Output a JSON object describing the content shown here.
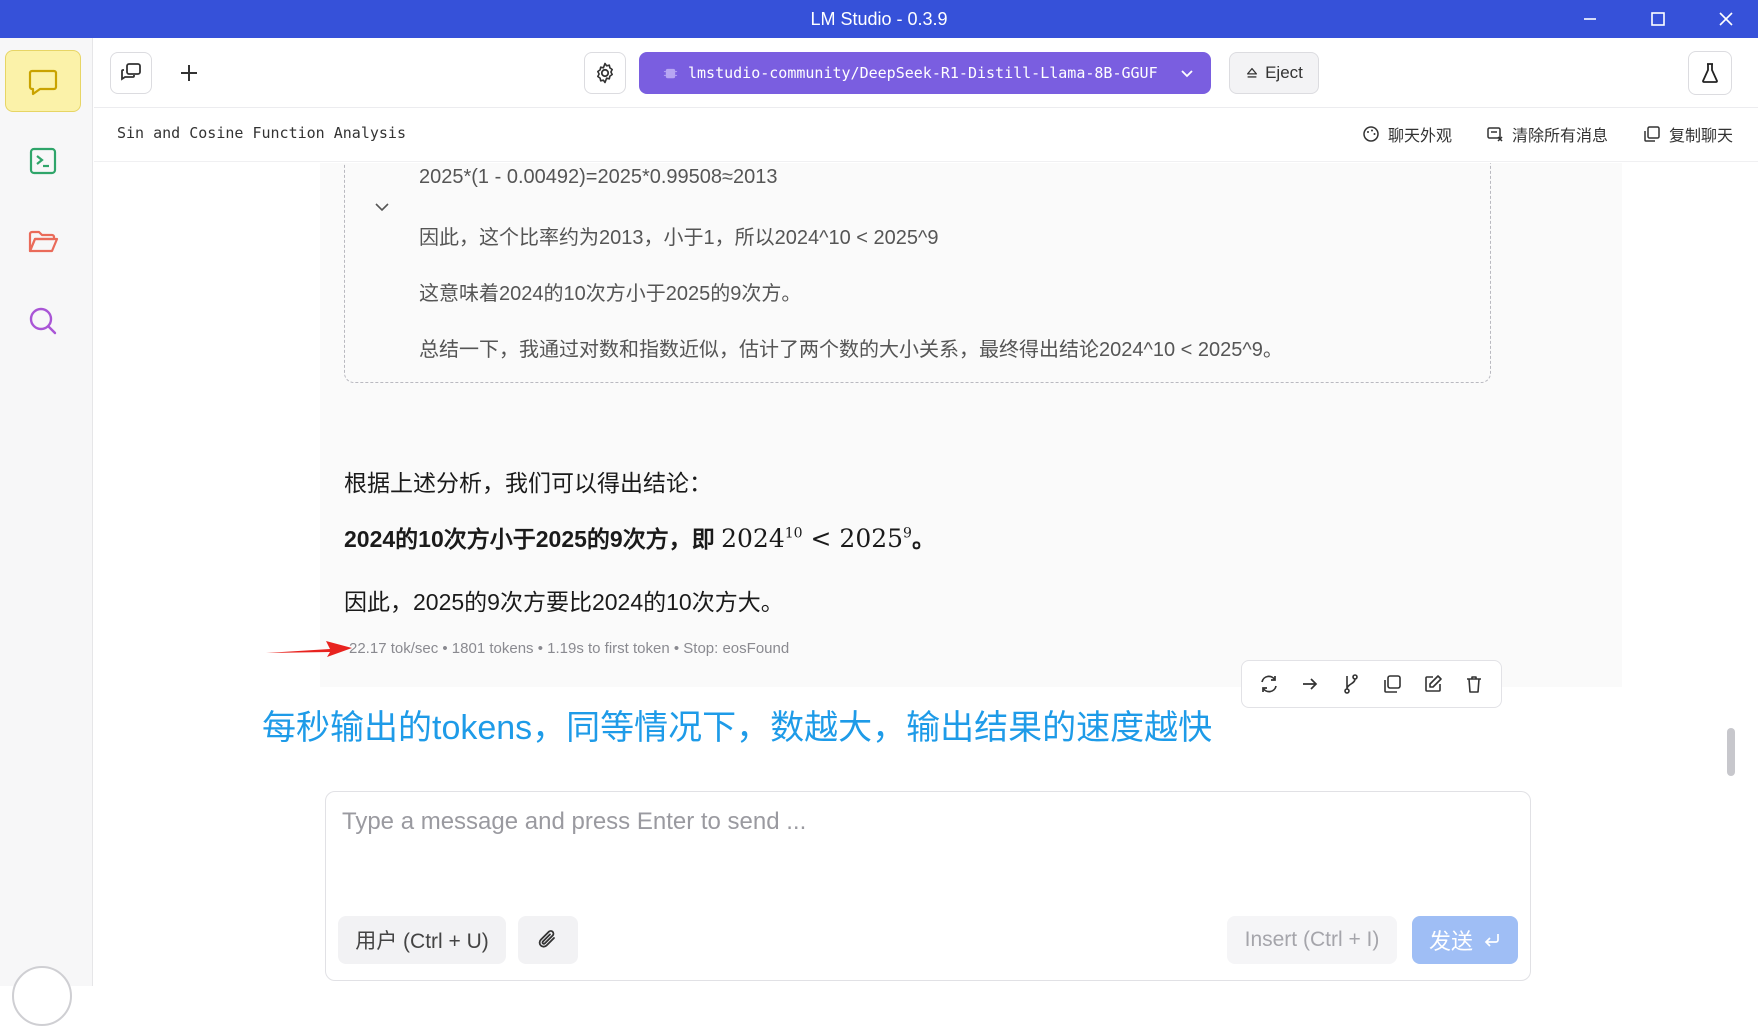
{
  "window": {
    "title": "LM Studio - 0.3.9"
  },
  "sidebar": {
    "items": [
      {
        "icon": "chat-icon",
        "active": true
      },
      {
        "icon": "terminal-icon",
        "active": false
      },
      {
        "icon": "folder-icon",
        "active": false
      },
      {
        "icon": "search-icon",
        "active": false
      }
    ]
  },
  "toolbar": {
    "model_name": "lmstudio-community/DeepSeek-R1-Distill-Llama-8B-GGUF",
    "eject_label": "Eject"
  },
  "chat_header": {
    "title": "Sin and Cosine Function Analysis",
    "actions": [
      "聊天外观",
      "清除所有消息",
      "复制聊天"
    ]
  },
  "thought": {
    "lines": [
      "2025*(1 - 0.00492)=2025*0.99508≈2013",
      "因此，这个比率约为2013，小于1，所以2024^10 < 2025^9",
      "这意味着2024的10次方小于2025的9次方。",
      "总结一下，我通过对数和指数近似，估计了两个数的大小关系，最终得出结论2024^10 < 2025^9。"
    ]
  },
  "answer": {
    "intro": "根据上述分析，我们可以得出结论：",
    "conclusion_bold": "2024的10次方小于2025的9次方，即",
    "math": {
      "base1": "2024",
      "exp1": "10",
      "op": "<",
      "base2": "2025",
      "exp2": "9"
    },
    "conclusion_end": "。",
    "final": "因此，2025的9次方要比2024的10次方大。"
  },
  "stats": {
    "text": "22.17 tok/sec • 1801 tokens • 1.19s to first token • Stop: eosFound"
  },
  "annotation": {
    "text": "每秒输出的tokens，同等情况下，数越大，输出结果的速度越快",
    "color": "#1e9be8",
    "arrow_color": "#e8231f"
  },
  "composer": {
    "placeholder": "Type a message and press Enter to send ...",
    "role_label": "用户 (Ctrl + U)",
    "insert_label": "Insert (Ctrl + I)",
    "send_label": "发送"
  },
  "colors": {
    "titlebar": "#3651d9",
    "model_button": "#7a5ee0",
    "send_button": "#9fbef5",
    "active_sidebar": "#fbf2a9"
  }
}
